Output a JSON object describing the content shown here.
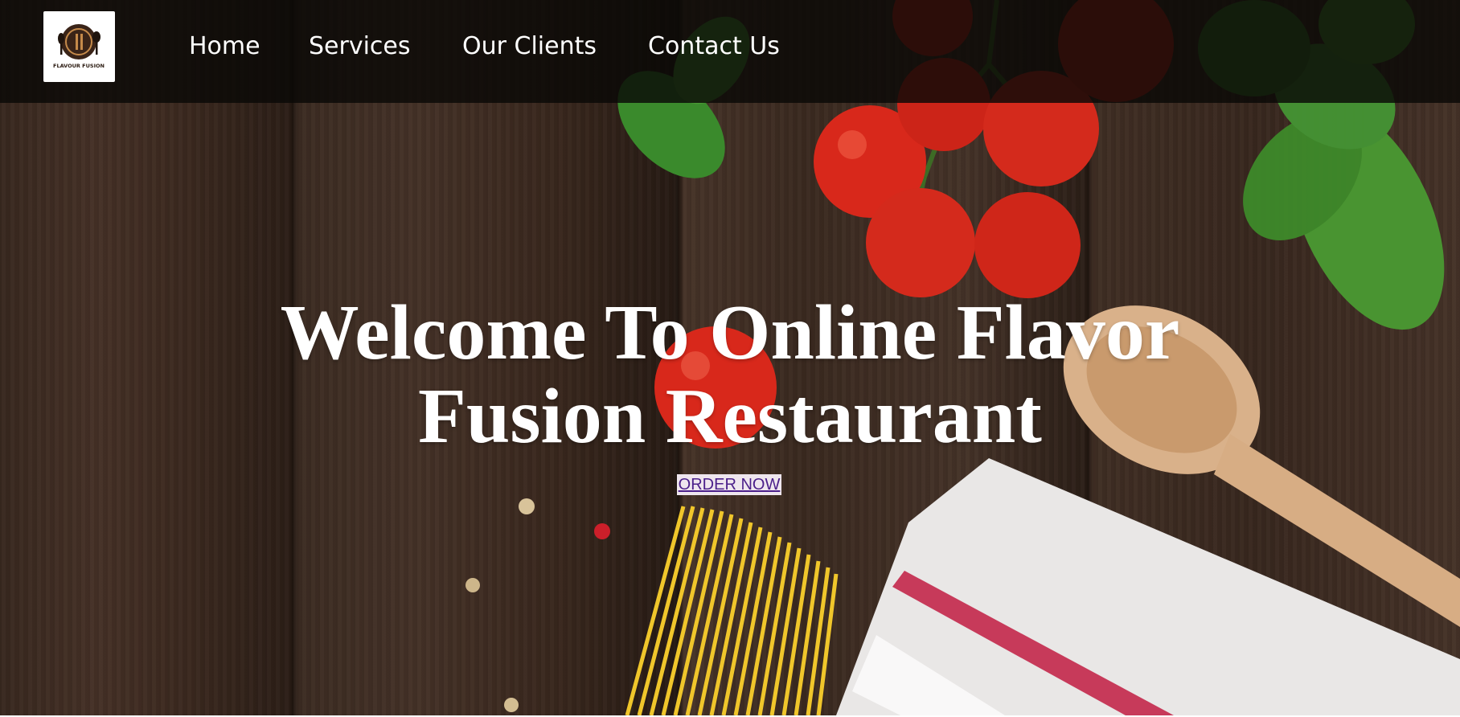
{
  "logo": {
    "text": "FLAVOUR FUSION",
    "icon": "plate-fork-spoon-icon"
  },
  "nav": {
    "items": [
      {
        "label": "Home"
      },
      {
        "label": "Services"
      },
      {
        "label": "Our Clients"
      },
      {
        "label": "Contact Us"
      }
    ]
  },
  "hero": {
    "title_line1": "Welcome To Online Flavor",
    "title_line2": "Fusion Restaurant",
    "cta_label": "ORDER NOW"
  },
  "colors": {
    "navbar_bg": "#0a0806",
    "title_text": "#ffffff",
    "cta_bg": "#efe6ee",
    "cta_text": "#4b1f8a",
    "wood": "#4e3629"
  }
}
